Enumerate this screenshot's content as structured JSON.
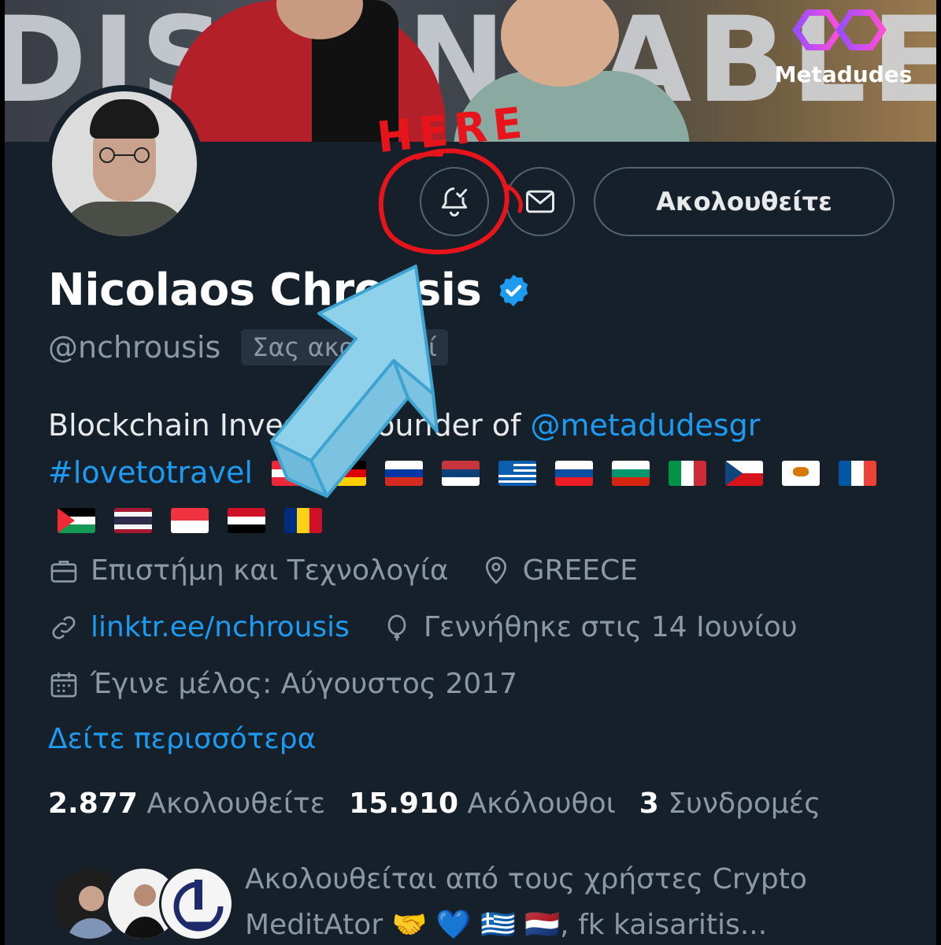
{
  "banner": {
    "logo_text": "Metadudes"
  },
  "profile": {
    "display_name": "Nicolaos Chrousis",
    "handle": "@nchrousis",
    "follows_you_badge": "Σας ακολουθεί",
    "follow_button_label": "Ακολουθείτε",
    "verified": true
  },
  "bio": {
    "text_prefix": "Blockchain Investor, Founder of ",
    "mention": "@metadudesgr",
    "hashtag": "#lovetotravel",
    "flags_row1": [
      "austria",
      "germany",
      "russia",
      "serbia",
      "greece",
      "slovakia",
      "bulgaria",
      "italy",
      "czechia",
      "cyprus",
      "france"
    ],
    "flags_row2": [
      "palestine",
      "thailand",
      "singapore",
      "egypt",
      "romania"
    ]
  },
  "meta": {
    "category": "Επιστήμη και Τεχνολογία",
    "location": "GREECE",
    "website": "linktr.ee/nchrousis",
    "birthday": "Γεννήθηκε στις 14 Ιουνίου",
    "joined": "Έγινε μέλος: Αύγουστος 2017",
    "see_more": "Δείτε περισσότερα"
  },
  "stats": {
    "following_count": "2.877",
    "following_label": "Ακολουθείτε",
    "followers_count": "15.910",
    "followers_label": "Ακόλουθοι",
    "subscriptions_count": "3",
    "subscriptions_label": "Συνδρομές"
  },
  "followed_by": {
    "line1": "Ακολουθείται από τους χρήστες Crypto",
    "line2": "MeditAtor 🤝 💙 🇬🇷 🇳🇱, fk kaisaritis..."
  },
  "annotation": {
    "here_text": "HERE",
    "circle_color": "#e8141b",
    "arrow_color": "#8fd0ea"
  },
  "colors": {
    "background": "#15202b",
    "accent": "#1d9bf0",
    "muted_text": "#8b98a5",
    "border": "#536471"
  }
}
